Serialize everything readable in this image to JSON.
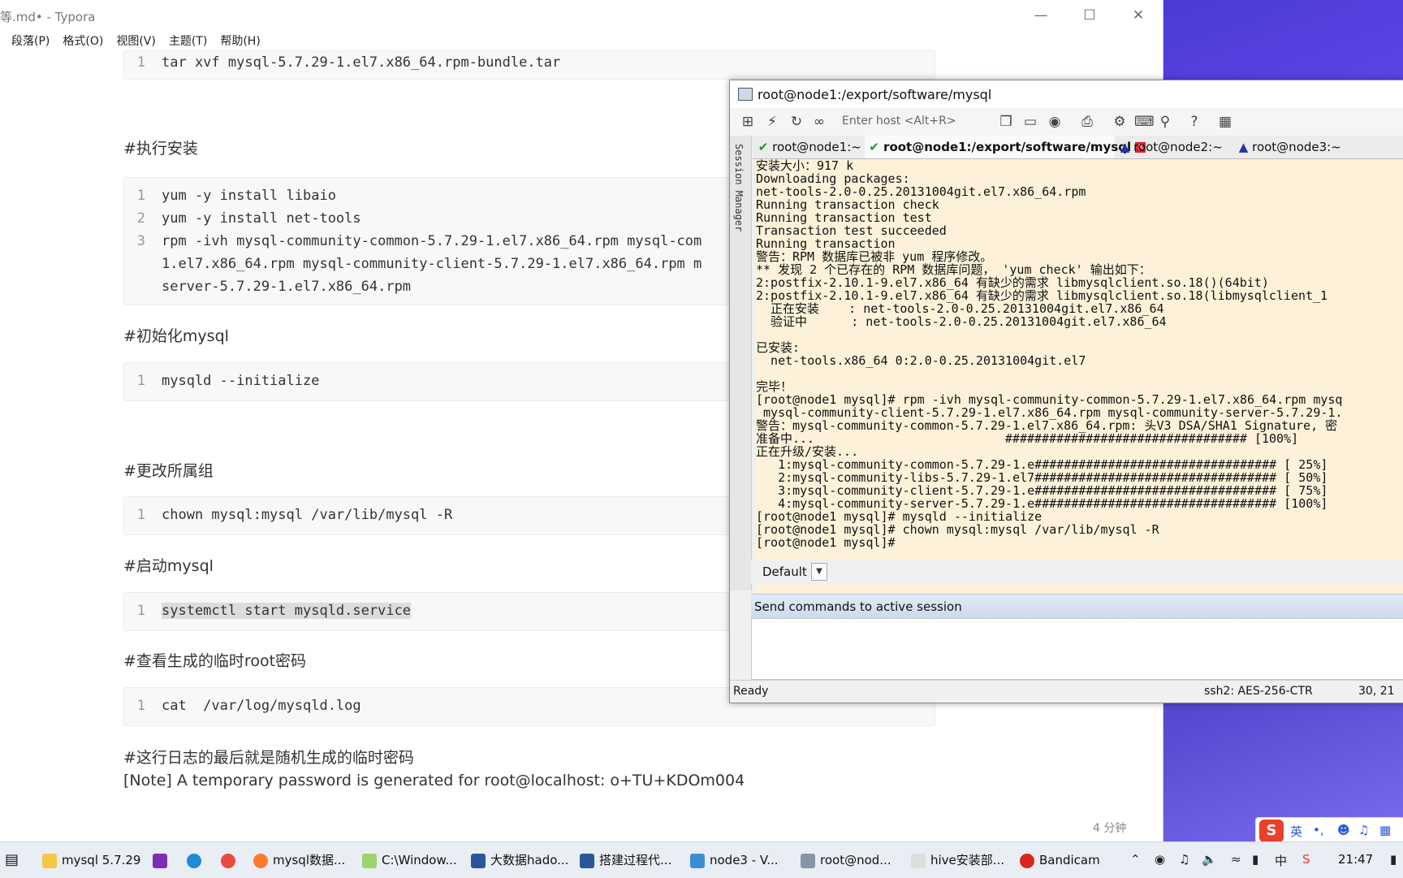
{
  "typora": {
    "title": "等.md• - Typora",
    "menu": [
      "段落(P)",
      "格式(O)",
      "视图(V)",
      "主题(T)",
      "帮助(H)"
    ],
    "code1": {
      "n": "1",
      "line": "tar xvf mysql-5.7.29-1.el7.x86_64.rpm-bundle.tar"
    },
    "h_install": "#执行安装",
    "code2": {
      "n1": "1",
      "l1": "yum -y install libaio",
      "n2": "2",
      "l2": "yum -y install net-tools",
      "n3": "3",
      "l3": "rpm -ivh mysql-community-common-5.7.29-1.el7.x86_64.rpm mysql-com",
      "l3b": "1.el7.x86_64.rpm mysql-community-client-5.7.29-1.el7.x86_64.rpm m",
      "l3c": "server-5.7.29-1.el7.x86_64.rpm"
    },
    "h_init": "#初始化mysql",
    "code3": {
      "n": "1",
      "line": "mysqld --initialize"
    },
    "h_chown": "#更改所属组",
    "code4": {
      "n": "1",
      "line": "chown mysql:mysql /var/lib/mysql -R"
    },
    "h_start": "#启动mysql",
    "code5": {
      "n": "1",
      "line": "systemctl start mysqld.service"
    },
    "h_view": "#查看生成的临时root密码",
    "code6": {
      "n": "1",
      "line": "cat  /var/log/mysqld.log"
    },
    "h_last": "#这行日志的最后就是随机生成的临时密码",
    "note": "[Note] A temporary password is generated for root@localhost: o+TU+KDOm004",
    "word_count": "4 分钟"
  },
  "ssh": {
    "title": "root@node1:/export/software/mysql",
    "host_placeholder": "Enter host <Alt+R>",
    "tabs": [
      "root@node1:~",
      "root@node1:/export/software/mysql",
      "root@node2:~",
      "root@node3:~"
    ],
    "session_manager": "Session Manager",
    "terminal_lines": [
      "安装大小：917 k",
      "Downloading packages:",
      "net-tools-2.0-0.25.20131004git.el7.x86_64.rpm",
      "Running transaction check",
      "Running transaction test",
      "Transaction test succeeded",
      "Running transaction",
      "警告：RPM 数据库已被非 yum 程序修改。",
      "** 发现 2 个已存在的 RPM 数据库问题， 'yum check' 输出如下：",
      "2:postfix-2.10.1-9.el7.x86_64 有缺少的需求 libmysqlclient.so.18()(64bit)",
      "2:postfix-2.10.1-9.el7.x86_64 有缺少的需求 libmysqlclient.so.18(libmysqlclient_1",
      "  正在安装    : net-tools-2.0-0.25.20131004git.el7.x86_64",
      "  验证中      : net-tools-2.0-0.25.20131004git.el7.x86_64",
      "",
      "已安装:",
      "  net-tools.x86_64 0:2.0-0.25.20131004git.el7",
      "",
      "完毕！",
      "[root@node1 mysql]# rpm -ivh mysql-community-common-5.7.29-1.el7.x86_64.rpm mysq",
      " mysql-community-client-5.7.29-1.el7.x86_64.rpm mysql-community-server-5.7.29-1.",
      "警告：mysql-community-common-5.7.29-1.el7.x86_64.rpm: 头V3 DSA/SHA1 Signature, 密",
      "准备中...                          ################################# [100%]",
      "正在升级/安装...",
      "   1:mysql-community-common-5.7.29-1.e################################# [ 25%]",
      "   2:mysql-community-libs-5.7.29-1.el7################################# [ 50%]",
      "   3:mysql-community-client-5.7.29-1.e################################# [ 75%]",
      "   4:mysql-community-server-5.7.29-1.e################################# [100%]",
      "[root@node1 mysql]# mysqld --initialize",
      "[root@node1 mysql]# chown mysql:mysql /var/lib/mysql -R",
      "[root@node1 mysql]# "
    ],
    "command_window_mode": "Default",
    "send_commands_label": "Send commands to active session",
    "status_ready": "Ready",
    "status_cipher": "ssh2: AES-256-CTR",
    "status_pos": "30, 21"
  },
  "taskbar": {
    "items": [
      "mysql 5.7.29",
      "mysql数据...",
      "C:\\Window...",
      "大数据hado...",
      "搭建过程代...",
      "node3 - V...",
      "root@nod...",
      "hive安装部...",
      "Bandicam"
    ],
    "ime_lang": "英",
    "tray_lang": "中",
    "clock": "21:47"
  }
}
